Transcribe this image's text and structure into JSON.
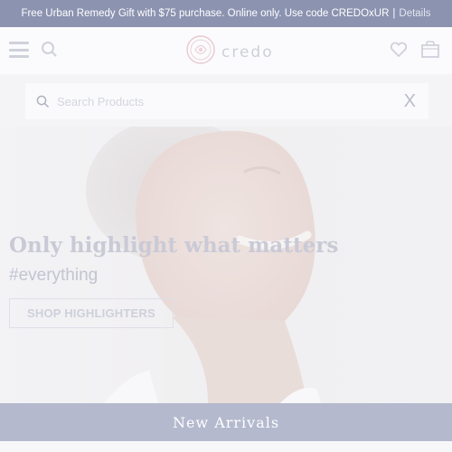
{
  "promo": {
    "message": "Free Urban Remedy Gift with $75 purchase. Online only. Use code CREDOxUR",
    "separator": "|",
    "details_label": "Details"
  },
  "header": {
    "menu_icon": "hamburger-menu-icon",
    "search_icon": "search-icon",
    "logo_text": "credo",
    "wishlist_icon": "heart-icon",
    "cart_icon": "shopping-bag-icon"
  },
  "search": {
    "placeholder": "Search Products",
    "clear_label": "X"
  },
  "hero": {
    "title": "Only highlight what matters",
    "tagline": "#everything",
    "cta_label": "SHOP HIGHLIGHTERS"
  },
  "banner": {
    "label": "New Arrivals"
  },
  "colors": {
    "promo_bg": "#8b93b0",
    "banner_bg": "#b4b9ce",
    "text_muted": "#c9cad6"
  }
}
